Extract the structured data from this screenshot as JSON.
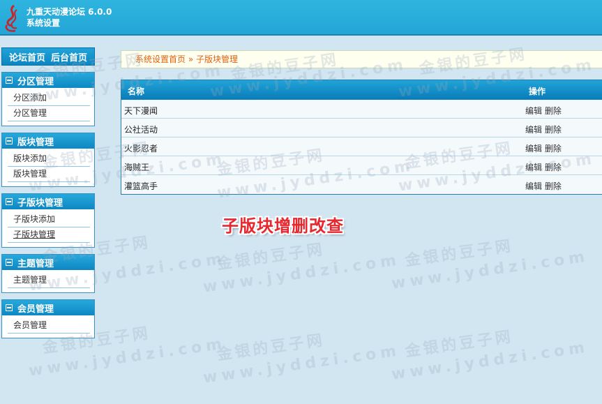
{
  "header": {
    "title_line1": "九重天动漫论坛 6.0.0",
    "title_line2": "系统设置"
  },
  "sidebar": {
    "top_links": [
      "论坛首页",
      "后台首页"
    ],
    "groups": [
      {
        "title": "分区管理",
        "items": [
          "分区添加",
          "分区管理"
        ]
      },
      {
        "title": "版块管理",
        "items": [
          "版块添加",
          "版块管理"
        ]
      },
      {
        "title": "子版块管理",
        "items": [
          "子版块添加",
          "子版块管理"
        ]
      },
      {
        "title": "主题管理",
        "items": [
          "主题管理"
        ]
      },
      {
        "title": "会员管理",
        "items": [
          "会员管理"
        ]
      }
    ]
  },
  "breadcrumb": {
    "home": "系统设置首页",
    "separator": "»",
    "current": "子版块管理"
  },
  "table": {
    "headers": {
      "name": "名称",
      "ops": "操作"
    },
    "rows": [
      {
        "name": "天下漫闻",
        "edit": "编辑",
        "delete": "删除"
      },
      {
        "name": "公社活动",
        "edit": "编辑",
        "delete": "删除"
      },
      {
        "name": "火影忍者",
        "edit": "编辑",
        "delete": "删除"
      },
      {
        "name": "海贼王",
        "edit": "编辑",
        "delete": "删除"
      },
      {
        "name": "灌篮高手",
        "edit": "编辑",
        "delete": "删除"
      }
    ]
  },
  "caption": "子版块增删改查",
  "watermark": {
    "cn": "金银的豆子网",
    "url": "www.jyddzi.com"
  },
  "colors": {
    "header": "#23a6d6",
    "accent_red": "#e8262e",
    "breadcrumb_text": "#e06010"
  }
}
